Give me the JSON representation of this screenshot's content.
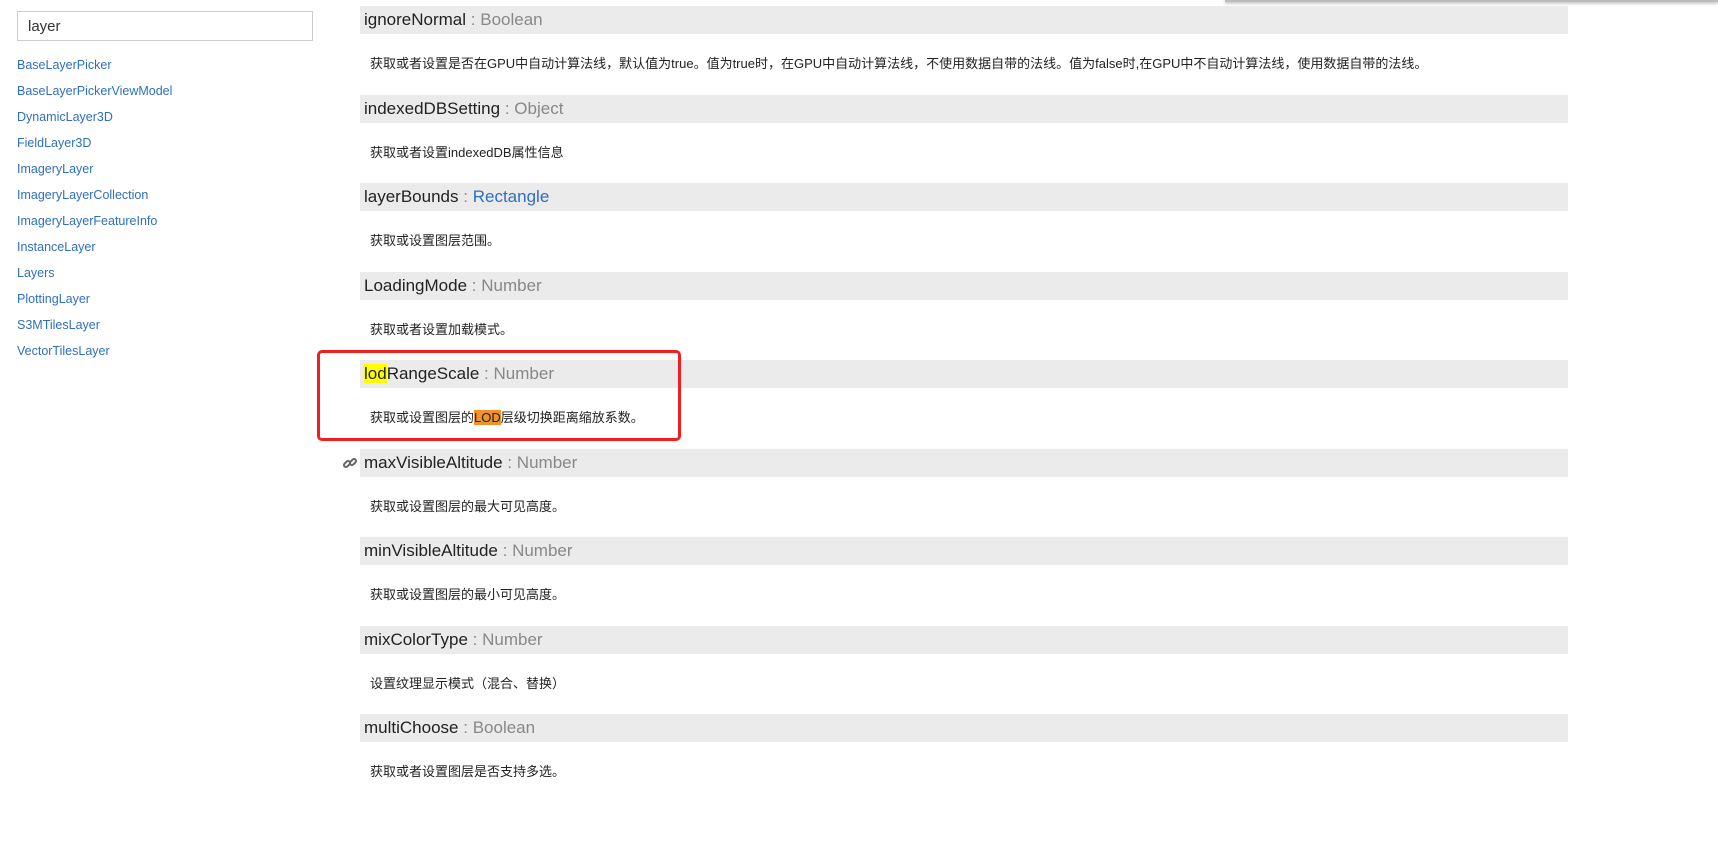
{
  "search": {
    "value": "layer"
  },
  "sidebar": {
    "items": [
      "BaseLayerPicker",
      "BaseLayerPickerViewModel",
      "DynamicLayer3D",
      "FieldLayer3D",
      "ImageryLayer",
      "ImageryLayerCollection",
      "ImageryLayerFeatureInfo",
      "InstanceLayer",
      "Layers",
      "PlottingLayer",
      "S3MTilesLayer",
      "VectorTilesLayer"
    ]
  },
  "members": [
    {
      "name": "ignoreNormal",
      "type": "Boolean",
      "desc": "获取或者设置是否在GPU中自动计算法线，默认值为true。值为true时，在GPU中自动计算法线，不使用数据自带的法线。值为false时,在GPU中不自动计算法线，使用数据自带的法线。"
    },
    {
      "name": "indexedDBSetting",
      "type": "Object",
      "desc": "获取或者设置indexedDB属性信息"
    },
    {
      "name": "layerBounds",
      "type": "Rectangle",
      "desc": "获取或设置图层范围。"
    },
    {
      "name": "LoadingMode",
      "type": "Number",
      "desc": "获取或者设置加载模式。"
    },
    {
      "name_hl": "lod",
      "name_rest": "RangeScale",
      "type": "Number",
      "desc_pre": "获取或设置图层的",
      "desc_hl": "LOD",
      "desc_post": "层级切换距离缩放系数。"
    },
    {
      "name": "maxVisibleAltitude",
      "type": "Number",
      "desc": "获取或设置图层的最大可见高度。"
    },
    {
      "name": "minVisibleAltitude",
      "type": "Number",
      "desc": "获取或设置图层的最小可见高度。"
    },
    {
      "name": "mixColorType",
      "type": "Number",
      "desc": "设置纹理显示模式（混合、替换）"
    },
    {
      "name": "multiChoose",
      "type": "Boolean",
      "desc": "获取或者设置图层是否支持多选。"
    }
  ],
  "separator": ":",
  "colors": {
    "link": "#2f6fbf",
    "highlight_search": "#ffff00",
    "highlight_match": "#f0932b",
    "annotation_box": "#f02020",
    "header_bg": "#ebebeb"
  }
}
